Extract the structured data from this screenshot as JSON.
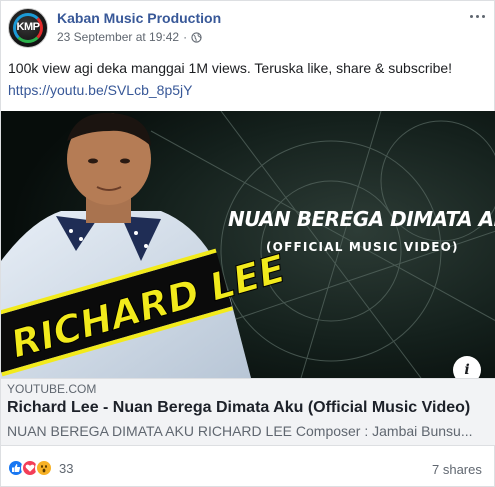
{
  "post": {
    "page_name": "Kaban Music Production",
    "avatar_text": "KMP",
    "timestamp": "23 September at 19:42",
    "separator": "·",
    "privacy_icon": "globe-icon",
    "more_icon": "more-options-icon",
    "text": "100k view agi deka manggai 1M views. Teruska like, share & subscribe!",
    "link": "https://youtu.be/SVLcb_8p5jY"
  },
  "video": {
    "thumbnail_title": "NUAN BEREGA DIMATA AKU",
    "thumbnail_subtitle": "(OFFICIAL MUSIC VIDEO)",
    "thumbnail_artist": "RICHARD LEE",
    "info_icon": "i",
    "domain": "YOUTUBE.COM",
    "title": "Richard Lee - Nuan Berega Dimata Aku (Official Music Video)",
    "description": "NUAN BEREGA DIMATA AKU RICHARD LEE Composer : Jambai Bunsu..."
  },
  "footer": {
    "reaction_icons": [
      "like-icon",
      "love-icon",
      "wow-icon"
    ],
    "reaction_count": "33",
    "shares": "7 shares"
  },
  "colors": {
    "page_name": "#385898",
    "link": "#385898",
    "artist_yellow": "#f2ea1c",
    "like": "#1877f2",
    "love": "#f33e58",
    "wow": "#f7b125"
  }
}
